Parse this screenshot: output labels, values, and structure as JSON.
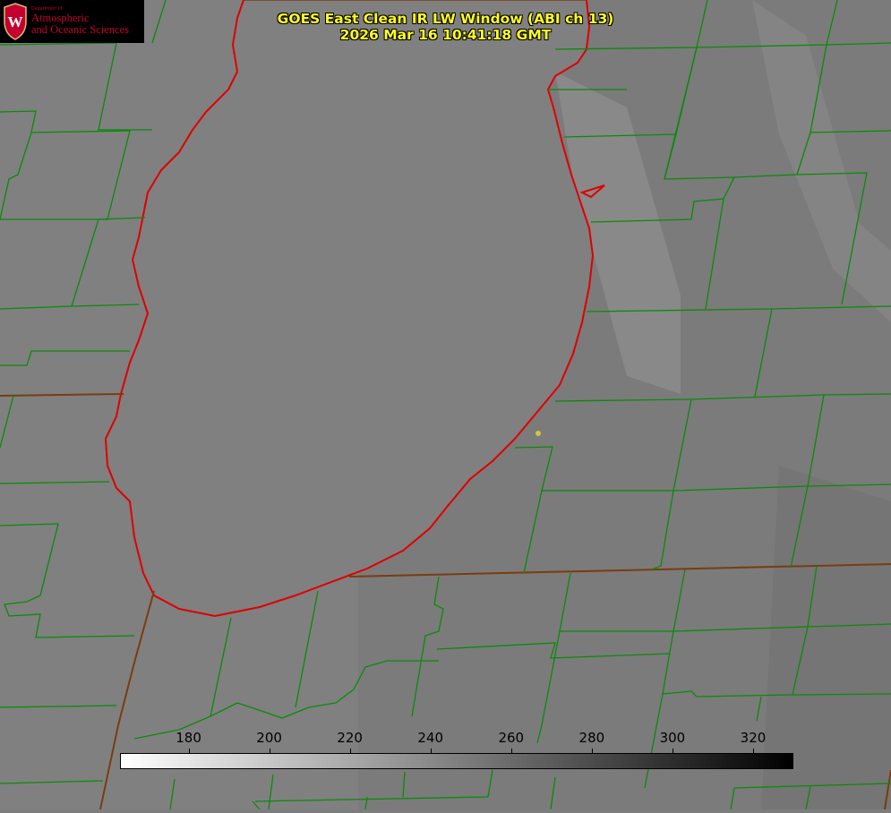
{
  "title": {
    "line1": "GOES East Clean IR LW Window (ABI ch 13)",
    "line2": "2026 Mar 16 10:41:18 GMT"
  },
  "logo": {
    "crest_letter": "W",
    "small_text": "Department of",
    "line1": "Atmospheric",
    "line2": "and Oceanic Sciences"
  },
  "colorbar": {
    "ticks": [
      "180",
      "200",
      "220",
      "240",
      "260",
      "280",
      "300",
      "320"
    ],
    "min": 163,
    "max": 330,
    "low_color": "#ffffff",
    "high_color": "#000000"
  },
  "colors": {
    "background": "#7d7d7d",
    "lake": "#808080",
    "county_lines": "#0a8a0a",
    "state_lines": "#8a5a10",
    "shoreline": "#e00000",
    "title_text": "#ffff22",
    "logo_text": "#c4002f"
  }
}
